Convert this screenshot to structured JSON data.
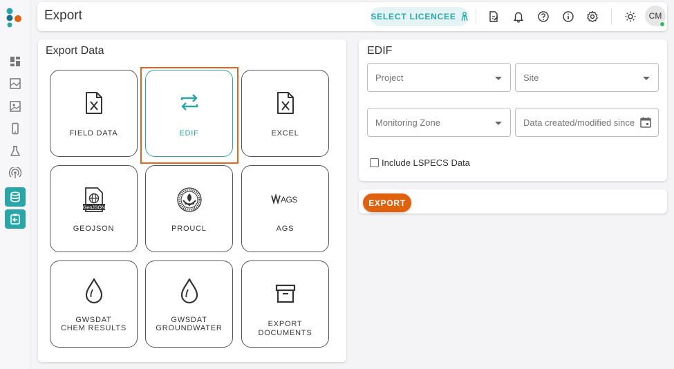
{
  "header": {
    "title": "Export",
    "select_licencee": "SELECT LICENCEE",
    "avatar_initials": "CM"
  },
  "export_panel": {
    "title": "Export Data",
    "tiles": [
      {
        "label": "FIELD DATA",
        "icon": "excel-file-icon"
      },
      {
        "label": "EDIF",
        "icon": "swap-arrows-icon",
        "selected": true
      },
      {
        "label": "EXCEL",
        "icon": "excel-file-icon"
      },
      {
        "label": "GEOJSON",
        "icon": "geojson-file-icon",
        "icon_text": "GeoJSON"
      },
      {
        "label": "PROUCL",
        "icon": "epa-seal-icon"
      },
      {
        "label": "AGS",
        "icon": "ags-logo-icon",
        "icon_text": "AGS"
      },
      {
        "label_line1": "GWSDAT",
        "label_line2": "CHEM RESULTS",
        "icon": "water-drop-icon"
      },
      {
        "label_line1": "GWSDAT",
        "label_line2": "GROUNDWATER",
        "icon": "water-drop-icon"
      },
      {
        "label": "EXPORT DOCUMENTS",
        "icon": "archive-box-icon"
      }
    ]
  },
  "edif_panel": {
    "title": "EDIF",
    "project_placeholder": "Project",
    "site_placeholder": "Site",
    "monitoring_zone_placeholder": "Monitoring Zone",
    "date_placeholder": "Data created/modified since",
    "include_lspecs_label": "Include LSPECS Data",
    "include_lspecs_checked": false
  },
  "actions": {
    "export_label": "EXPORT"
  },
  "colors": {
    "accent_teal": "#2aa6a8",
    "export_orange": "#e0620f",
    "highlight_orange": "#e8641a"
  }
}
